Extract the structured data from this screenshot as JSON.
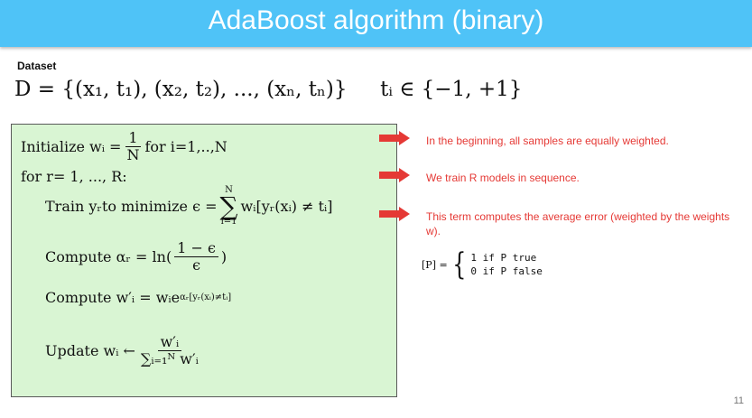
{
  "header": {
    "title": "AdaBoost algorithm (binary)"
  },
  "dataset": {
    "label": "Dataset",
    "equation": "D = {(x₁, t₁), (x₂, t₂), ..., (xₙ, tₙ)}",
    "domain": "tᵢ ∈ {−1, +1}"
  },
  "algorithm": {
    "init_prefix": "Initialize wᵢ =",
    "init_num": "1",
    "init_den": "N",
    "init_suffix": "for i=1,..,N",
    "loop": "for r= 1, ..., R:",
    "train_prefix": "Train yᵣto minimize ϵ =",
    "train_sum_top": "N",
    "train_sum_bottom": "i=1",
    "train_term": "wᵢ[yᵣ(xᵢ) ≠ tᵢ]",
    "alpha_prefix": "Compute αᵣ = ln(",
    "alpha_num": "1 − ϵ",
    "alpha_den": "ϵ",
    "alpha_suffix": ")",
    "wprime_prefix": "Compute w′ᵢ = wᵢe",
    "wprime_exp": "αᵣ[yᵣ(xᵢ)≠tᵢ]",
    "update_prefix": "Update wᵢ ←",
    "update_num": "w′ᵢ",
    "update_den": "∑ᵢ₌₁ᴺ w′ᵢ"
  },
  "notes": [
    "In the beginning, all samples are equally weighted.",
    "We train R models in sequence.",
    "This term computes the average error (weighted by the weights w)."
  ],
  "iverson": {
    "lhs": "[P] =",
    "case_true": "1 if P true",
    "case_false": "0 if P false"
  },
  "page_number": "11",
  "colors": {
    "header": "#4fc3f7",
    "box": "#d9f5d3",
    "arrow": "#e53935",
    "note": "#e53935"
  }
}
